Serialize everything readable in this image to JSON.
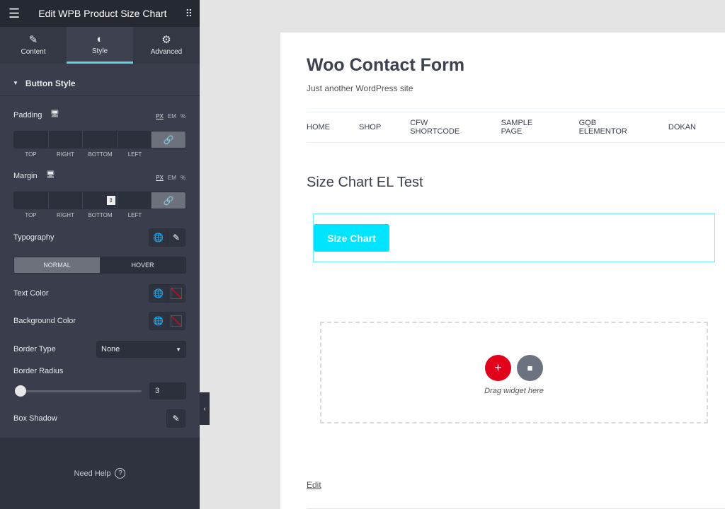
{
  "header": {
    "title": "Edit WPB Product Size Chart",
    "menu_icon": "hamburger-icon",
    "apps_icon": "grid-icon"
  },
  "tabs": [
    {
      "label": "Content",
      "icon": "pencil-icon"
    },
    {
      "label": "Style",
      "icon": "contrast-icon",
      "active": true
    },
    {
      "label": "Advanced",
      "icon": "gear-icon"
    }
  ],
  "section": {
    "title": "Button Style"
  },
  "padding": {
    "label": "Padding",
    "units": [
      "PX",
      "EM",
      "%"
    ],
    "sides": [
      "TOP",
      "RIGHT",
      "BOTTOM",
      "LEFT"
    ],
    "values": [
      "",
      "",
      "",
      ""
    ]
  },
  "margin": {
    "label": "Margin",
    "units": [
      "PX",
      "EM",
      "%"
    ],
    "sides": [
      "TOP",
      "RIGHT",
      "BOTTOM",
      "LEFT"
    ],
    "values": [
      "",
      "",
      "",
      ""
    ]
  },
  "typography": {
    "label": "Typography"
  },
  "state_toggle": {
    "normal": "NORMAL",
    "hover": "HOVER",
    "active": "NORMAL"
  },
  "text_color": {
    "label": "Text Color"
  },
  "background_color": {
    "label": "Background Color"
  },
  "border_type": {
    "label": "Border Type",
    "value": "None"
  },
  "border_radius": {
    "label": "Border Radius",
    "value": "3"
  },
  "box_shadow": {
    "label": "Box Shadow"
  },
  "footer": {
    "help": "Need Help",
    "icon": "?"
  },
  "colors": {
    "accent": "#00e5ff",
    "add_button": "#e2001a",
    "panel": "#3a3e4c"
  },
  "page": {
    "site_title": "Woo Contact Form",
    "tagline": "Just another WordPress site",
    "nav": [
      "HOME",
      "SHOP",
      "CFW SHORTCODE",
      "SAMPLE PAGE",
      "GQB ELEMENTOR",
      "DOKAN"
    ],
    "heading": "Size Chart EL Test",
    "size_chart_button": "Size Chart",
    "drop_text": "Drag widget here",
    "edit_link": "Edit"
  }
}
